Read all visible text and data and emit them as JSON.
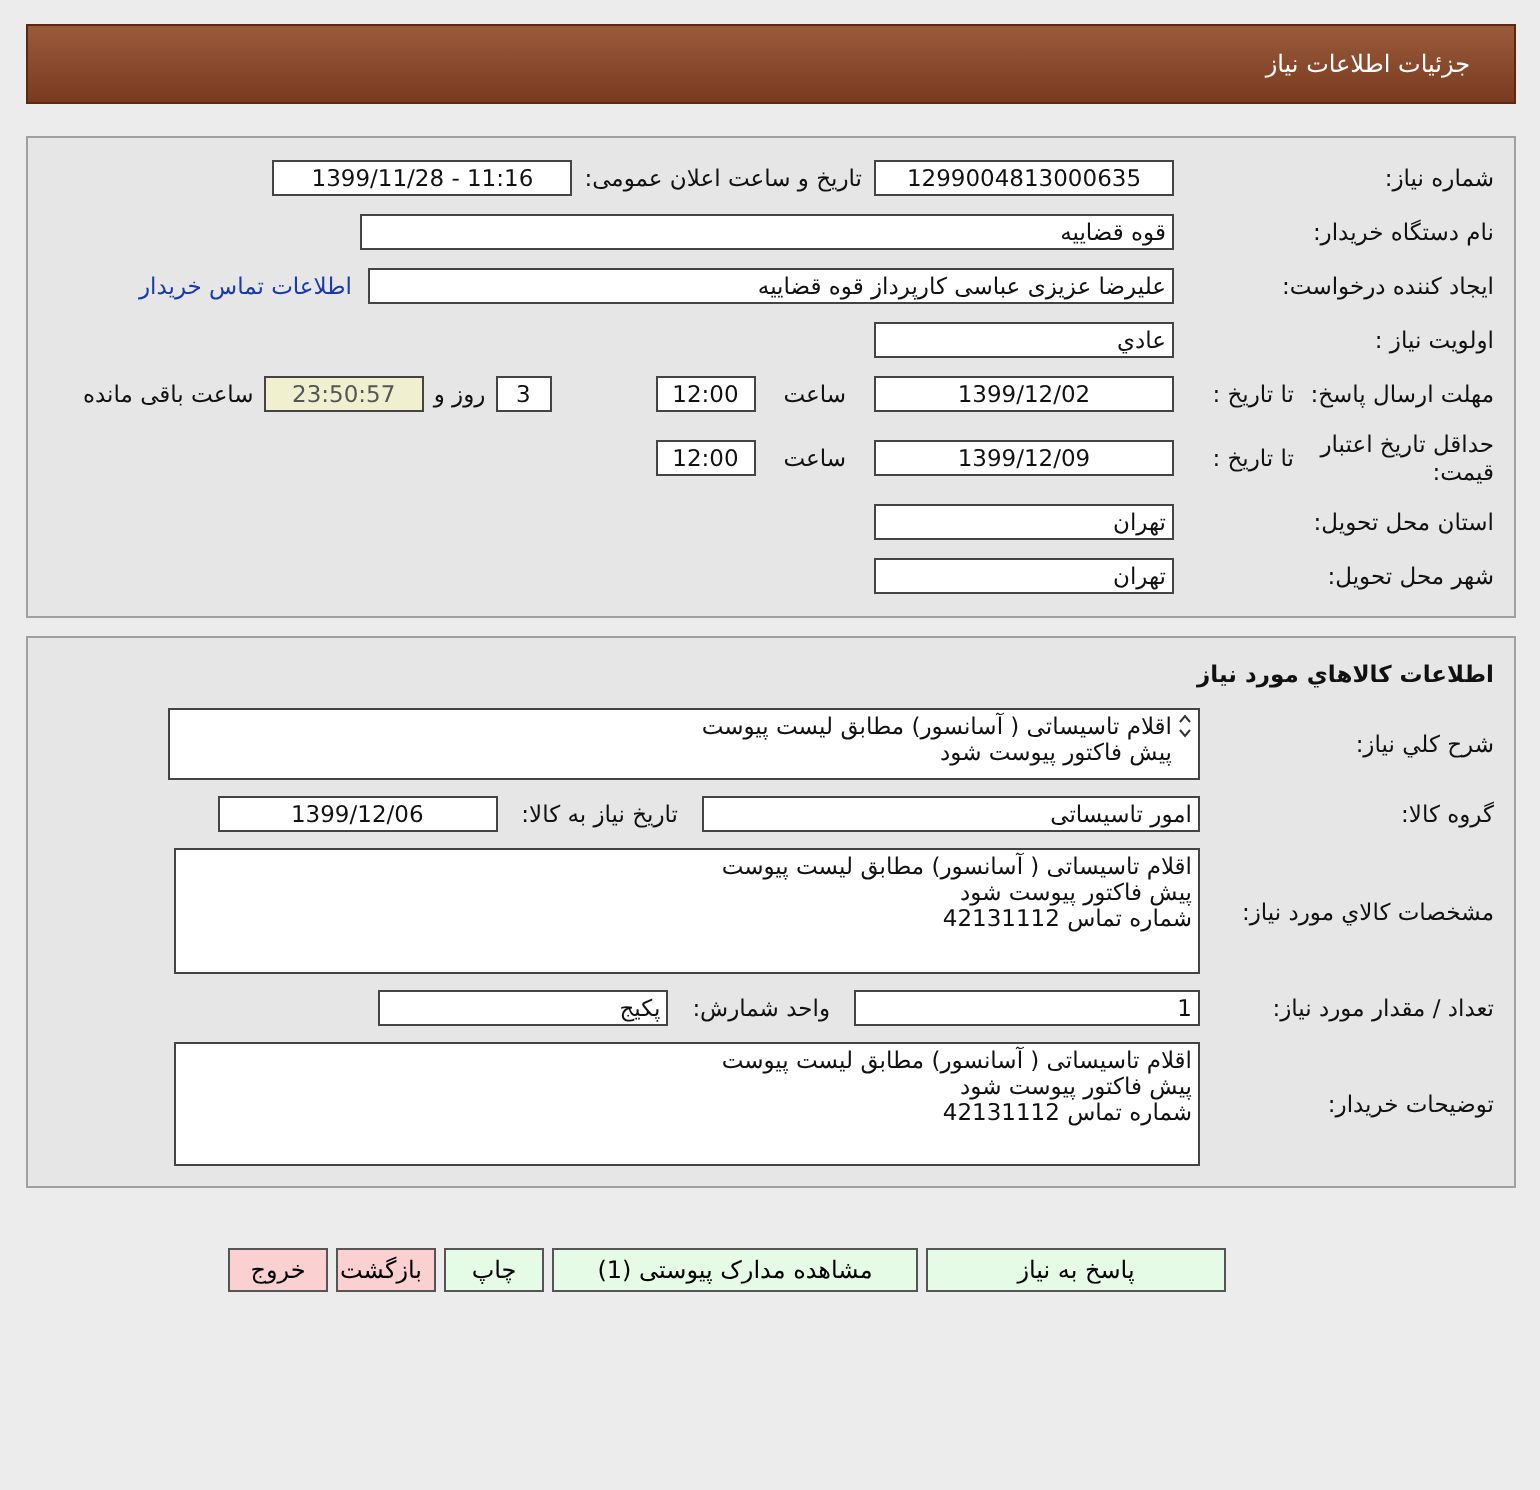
{
  "header": {
    "title": "جزئیات اطلاعات نیاز"
  },
  "need_info": {
    "need_number": {
      "label": "شماره نیاز:",
      "value": "1299004813000635"
    },
    "announce": {
      "label": "تاریخ و ساعت اعلان عمومی:",
      "value": "1399/11/28 - 11:16"
    },
    "buyer_org": {
      "label": "نام دستگاه خریدار:",
      "value": "قوه قضاییه"
    },
    "creator": {
      "label": "ایجاد کننده درخواست:",
      "value": "علیرضا  عزیزی عباسی کارپرداز قوه قضاییه",
      "link": "اطلاعات تماس خریدار"
    },
    "priority": {
      "label": "اولویت نیاز :",
      "value": "عادي"
    },
    "deadline": {
      "label": "مهلت ارسال پاسخ:",
      "to_date_label": "تا تاریخ :",
      "date": "1399/12/02",
      "time_label": "ساعت",
      "time": "12:00",
      "days": "3",
      "days_label": "روز و",
      "remaining": "23:50:57",
      "remaining_label": "ساعت باقی مانده"
    },
    "validity": {
      "label": "حداقل تاریخ اعتبار قیمت:",
      "to_date_label": "تا تاریخ :",
      "date": "1399/12/09",
      "time_label": "ساعت",
      "time": "12:00"
    },
    "province": {
      "label": "استان محل تحویل:",
      "value": "تهران"
    },
    "city": {
      "label": "شهر محل تحویل:",
      "value": "تهران"
    }
  },
  "goods": {
    "title": "اطلاعات کالاهاي مورد نياز",
    "summary": {
      "label": "شرح کلي نياز:",
      "lines": [
        "اقلام تاسیساتی ( آسانسور) مطابق لیست پیوست",
        "پیش فاکتور پیوست شود"
      ]
    },
    "group": {
      "label": "گروه کالا:",
      "value": "امور تاسیساتی",
      "need_date_label": "تاریخ نیاز به کالا:",
      "need_date": "1399/12/06"
    },
    "specs": {
      "label": "مشخصات کالاي مورد نياز:",
      "lines": [
        "اقلام تاسیساتی ( آسانسور) مطابق لیست پیوست",
        "پیش فاکتور پیوست شود",
        "شماره تماس 42131112"
      ]
    },
    "quantity": {
      "label": "تعداد / مقدار مورد نیاز:",
      "value": "1",
      "unit_label": "واحد شمارش:",
      "unit": "پکیج"
    },
    "buyer_notes": {
      "label": "توضیحات خریدار:",
      "lines": [
        "اقلام تاسیساتی ( آسانسور) مطابق لیست پیوست",
        "پیش فاکتور پیوست شود",
        "شماره تماس 42131112"
      ]
    }
  },
  "buttons": [
    {
      "label": "پاسخ به نیاز",
      "kind": "primary"
    },
    {
      "label": "مشاهده مدارک پیوستی (1)",
      "kind": "primary"
    },
    {
      "label": "چاپ",
      "kind": "primary"
    },
    {
      "label": "بازگشت",
      "kind": "danger"
    },
    {
      "label": "خروج",
      "kind": "danger"
    }
  ]
}
